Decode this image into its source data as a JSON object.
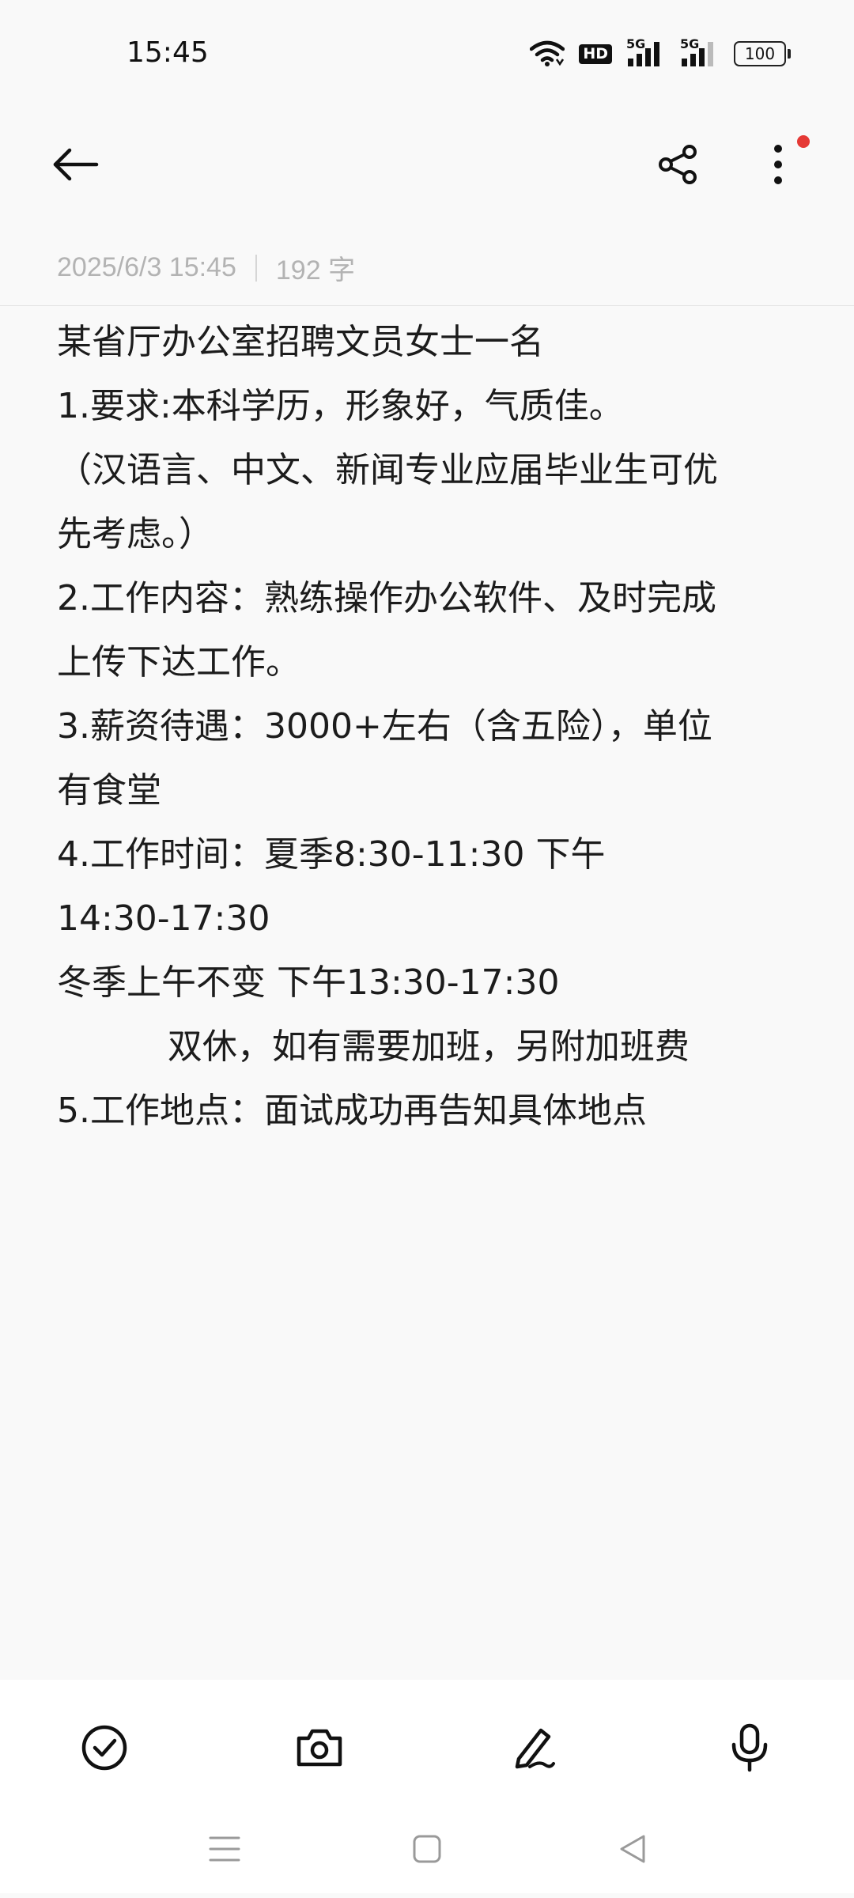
{
  "status_bar": {
    "time": "15:45",
    "hd_label": "HD",
    "signal_1_label": "5G",
    "signal_2_label": "5G",
    "battery_level": "100",
    "icons": [
      "wifi-icon",
      "hd-voice-icon",
      "signal-5g-icon",
      "signal-5g-icon",
      "battery-icon"
    ]
  },
  "app_bar": {
    "back_icon": "arrow-left-icon",
    "share_icon": "share-icon",
    "more_icon": "more-vertical-icon",
    "notification_dot_color": "#e53935"
  },
  "meta": {
    "date_time": "2025/6/3 15:45",
    "word_count": "192 字"
  },
  "note": {
    "lines": [
      "某省厅办公室招聘文员女士一名",
      "1.要求:本科学历，形象好，气质佳。",
      "（汉语言、中文、新闻专业应届毕业生可优",
      "先考虑。）",
      "2.工作内容：熟练操作办公软件、及时完成",
      "上传下达工作。",
      "3.薪资待遇：3000+左右（含五险），单位",
      "有食堂",
      "4.工作时间：夏季8:30-11:30 下午",
      "14:30-17:30",
      "冬季上午不变 下午13:30-17:30",
      "          双休，如有需要加班，另附加班费",
      "5.工作地点：面试成功再告知具体地点"
    ]
  },
  "toolbar": {
    "items": [
      "checklist-icon",
      "camera-icon",
      "pen-icon",
      "microphone-icon"
    ]
  },
  "nav_bar": {
    "items": [
      "menu-icon",
      "home-icon",
      "back-triangle-icon"
    ]
  }
}
